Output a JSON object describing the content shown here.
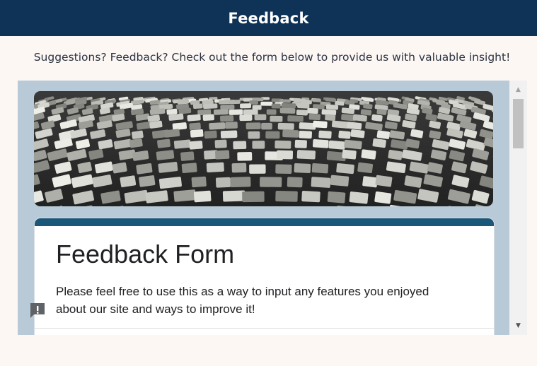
{
  "header": {
    "title": "Feedback"
  },
  "intro_text": "Suggestions? Feedback? Check out the form below to provide us with valuable insight!",
  "form": {
    "title": "Feedback Form",
    "description": "Please feel free to use this as a way to input any features you enjoyed about our site and ways to improve it!"
  },
  "icons": {
    "report": "report-feedback-icon",
    "scroll_up": "scroll-up-arrow",
    "scroll_down": "scroll-down-arrow"
  },
  "colors": {
    "header_bg": "#0e3357",
    "page_bg": "#fdf7f4",
    "frame_bg": "#b8cad8",
    "card_accent": "#1b5778"
  }
}
